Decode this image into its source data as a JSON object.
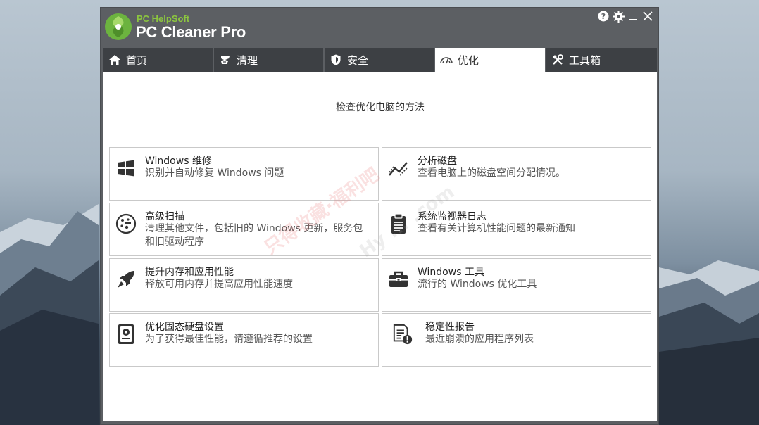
{
  "app": {
    "brand_small": "PC HelpSoft",
    "brand_big": "PC Cleaner Pro"
  },
  "controls": {
    "help_icon": "question-circle",
    "settings_icon": "gear",
    "minimize_icon": "minimize",
    "close_icon": "close"
  },
  "tabs": [
    {
      "label": "首页",
      "icon": "home"
    },
    {
      "label": "清理",
      "icon": "broom"
    },
    {
      "label": "安全",
      "icon": "shield"
    },
    {
      "label": "优化",
      "icon": "speedometer",
      "active": true
    },
    {
      "label": "工具箱",
      "icon": "tools"
    }
  ],
  "main": {
    "subtitle": "检查优化电脑的方法",
    "cards": [
      {
        "title": "Windows 维修",
        "desc": "识别并自动修复 Windows 问题",
        "icon": "windows"
      },
      {
        "title": "分析磁盘",
        "desc": "查看电脑上的磁盘空间分配情况。",
        "icon": "chart-line"
      },
      {
        "title": "高级扫描",
        "desc": "清理其他文件，包括旧的 Windows 更新，服务包和旧驱动程序",
        "icon": "scan"
      },
      {
        "title": "系统监视器日志",
        "desc": "查看有关计算机性能问题的最新通知",
        "icon": "clipboard"
      },
      {
        "title": "提升内存和应用性能",
        "desc": "释放可用内存并提高应用性能速度",
        "icon": "rocket"
      },
      {
        "title": "Windows 工具",
        "desc": "流行的 Windows 优化工具",
        "icon": "toolbox"
      },
      {
        "title": "优化固态硬盘设置",
        "desc": "为了获得最佳性能，请遵循推荐的设置",
        "icon": "ssd"
      },
      {
        "title": "稳定性报告",
        "desc": "最近崩溃的应用程序列表",
        "icon": "report"
      }
    ]
  },
  "watermark": {
    "text1": "只得收藏·福利吧",
    "text2": "Hy ... .com"
  }
}
